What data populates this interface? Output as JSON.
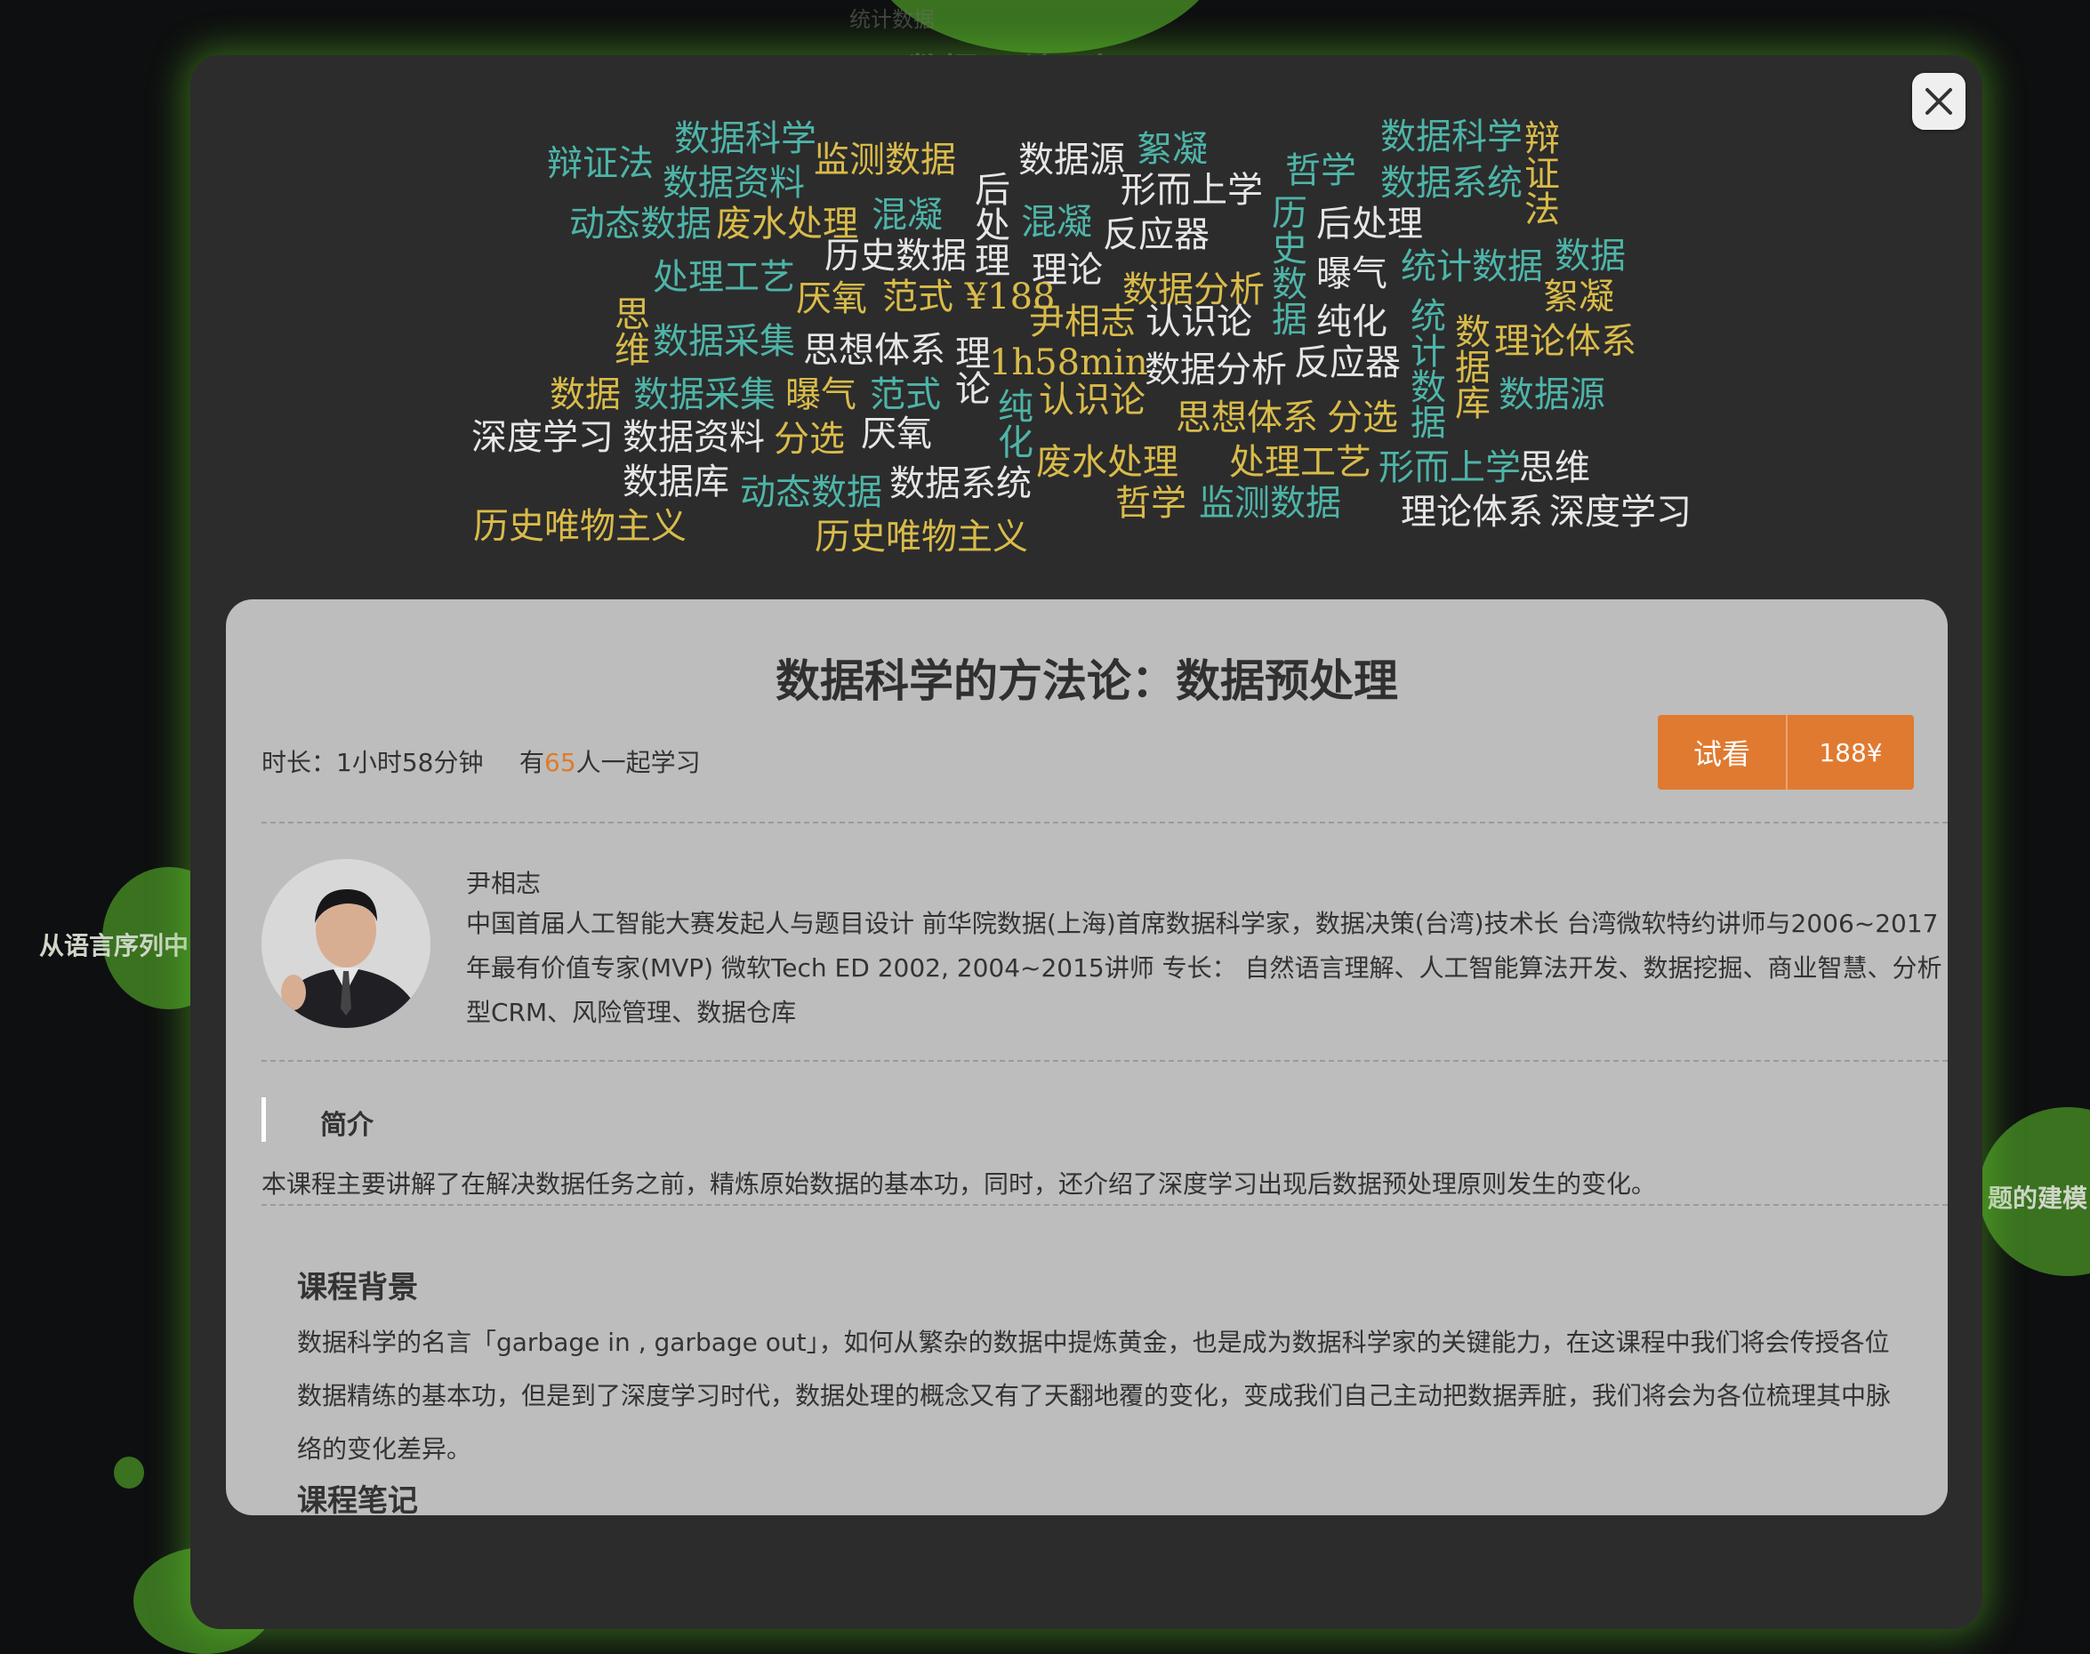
{
  "background": {
    "labels": [
      "从语言序列中",
      "统计数据",
      "数据无所不在",
      "题的建模"
    ]
  },
  "modal": {
    "close_icon": "close-icon",
    "word_cloud": [
      "辩证法",
      "数据科学",
      "监测数据",
      "数据源",
      "絮凝",
      "哲学",
      "数据科学",
      "辩证法",
      "数据资料",
      "形而上学",
      "数据系统",
      "动态数据",
      "废水处理",
      "混凝",
      "后处理",
      "混凝",
      "反应器",
      "历史数据",
      "历史数据",
      "后处理",
      "统计数据",
      "数据",
      "处理工艺",
      "理论",
      "数据分析",
      "曝气",
      "絮凝",
      "思维",
      "厌氧",
      "范式 ¥188",
      "尹相志",
      "认识论",
      "纯化",
      "统计数据",
      "数据库",
      "理论体系",
      "数据采集",
      "思想体系",
      "理论",
      "1h58min",
      "数据分析",
      "反应器",
      "数据源",
      "数据",
      "数据采集",
      "曝气",
      "范式",
      "认识论",
      "思想体系",
      "分选",
      "纯化",
      "深度学习",
      "数据资料",
      "分选",
      "厌氧",
      "废水处理",
      "处理工艺",
      "形而上学",
      "思维",
      "数据库",
      "动态数据",
      "数据系统",
      "哲学",
      "监测数据",
      "理论体系",
      "深度学习",
      "历史唯物主义",
      "历史唯物主义"
    ]
  },
  "course": {
    "title": "数据科学的方法论：数据预处理",
    "duration": "时长：1小时58分钟",
    "learners_prefix": "有",
    "learners_count": "65",
    "learners_suffix": "人一起学习",
    "try_label": "试看",
    "price_label": "188¥",
    "teacher_name": "尹相志",
    "teacher_bio": "中国首届人工智能大赛发起人与题目设计 前华院数据(上海)首席数据科学家，数据决策(台湾)技术长 台湾微软特约讲师与2006~2017年最有价值专家(MVP) 微软Tech ED 2002, 2004~2015讲师 专长： 自然语言理解、人工智能算法开发、数据挖掘、商业智慧、分析型CRM、风险管理、数据仓库",
    "intro_title": "简介",
    "intro_text": "本课程主要讲解了在解决数据任务之前，精炼原始数据的基本功，同时，还介绍了深度学习出现后数据预处理原则发生的变化。",
    "background_title": "课程背景",
    "background_text": "数据科学的名言「garbage in , garbage out」，如何从繁杂的数据中提炼黄金，也是成为数据科学家的关键能力，在这课程中我们将会传授各位数据精练的基本功，但是到了深度学习时代，数据处理的概念又有了天翻地覆的变化，变成我们自己主动把数据弄脏，我们将会为各位梳理其中脉络的变化差异。",
    "notes_title": "课程笔记"
  },
  "colors": {
    "accent": "#e07a30",
    "glow": "#5fc828"
  }
}
